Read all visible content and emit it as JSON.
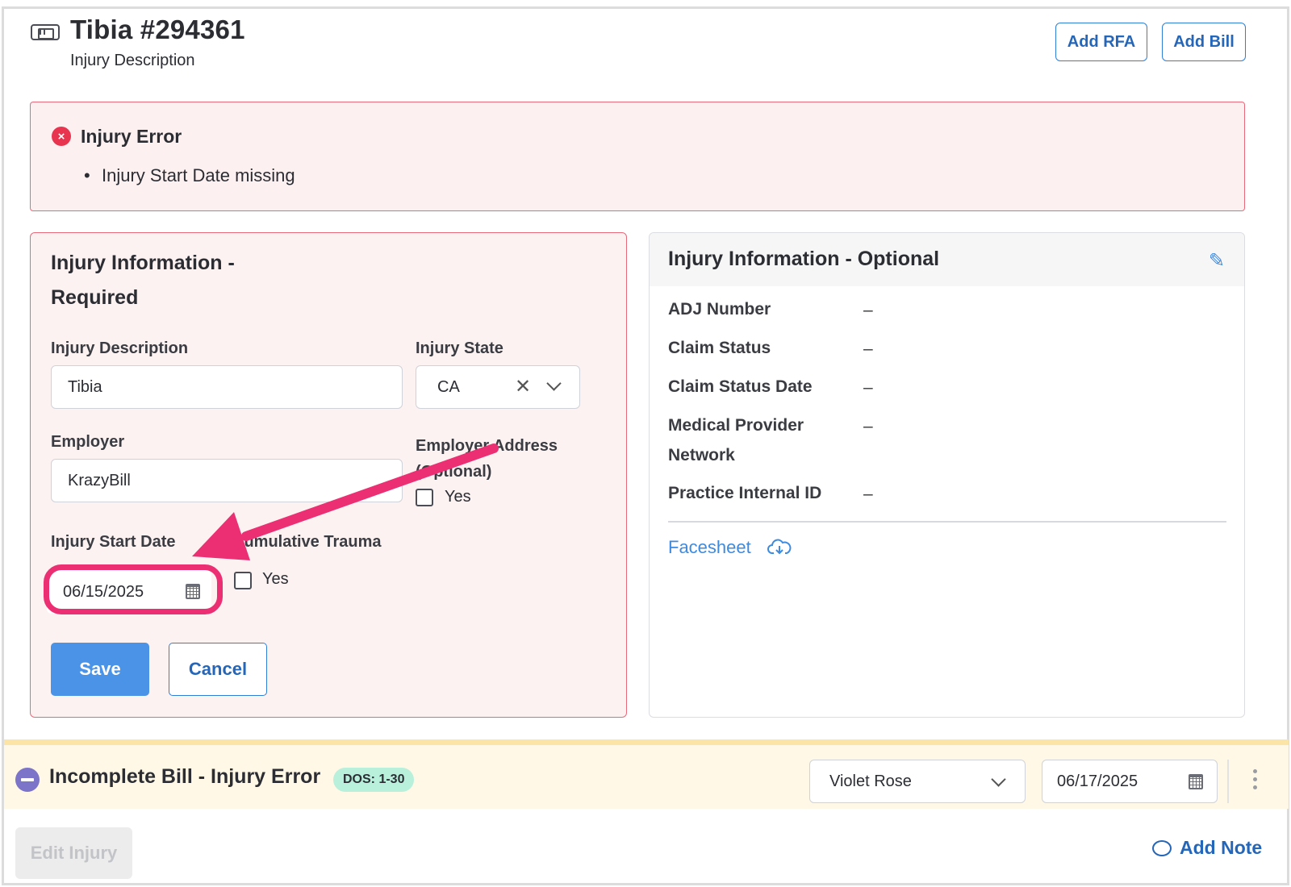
{
  "header": {
    "title": "Tibia #294361",
    "subtitle": "Injury Description",
    "add_rfa_label": "Add RFA",
    "add_bill_label": "Add Bill"
  },
  "error": {
    "title": "Injury Error",
    "items": [
      "Injury Start Date missing"
    ],
    "icon_glyph": "×"
  },
  "required_card": {
    "title": "Injury Information - Required",
    "injury_description_label": "Injury Description",
    "injury_description_value": "Tibia",
    "injury_state_label": "Injury State",
    "injury_state_value": "CA",
    "employer_label": "Employer",
    "employer_value": "KrazyBill",
    "employer_address_label": "Employer Address (Optional)",
    "employer_address_option": "Yes",
    "injury_start_date_label": "Injury Start Date",
    "injury_start_date_value": "06/15/2025",
    "cumulative_trauma_label": "Cumulative Trauma",
    "cumulative_trauma_option": "Yes",
    "save_label": "Save",
    "cancel_label": "Cancel"
  },
  "optional_card": {
    "title": "Injury Information - Optional",
    "rows": [
      {
        "label": "ADJ Number",
        "value": "–"
      },
      {
        "label": "Claim Status",
        "value": "–"
      },
      {
        "label": "Claim Status Date",
        "value": "–"
      },
      {
        "label": "Medical Provider Network",
        "value": "–"
      },
      {
        "label": "Practice Internal ID",
        "value": "–"
      }
    ],
    "facesheet_label": "Facesheet"
  },
  "bill": {
    "title": "Incomplete Bill - Injury Error",
    "dos_badge": "DOS: 1-30",
    "assignee": "Violet Rose",
    "date": "06/17/2025"
  },
  "footer": {
    "edit_injury_label": "Edit Injury",
    "add_note_label": "Add Note"
  },
  "colors": {
    "accent": "#2f7fd6",
    "error": "#e8344e",
    "highlight": "#ec2f72",
    "save": "#4a93e6",
    "badge": "#b8f0dc"
  }
}
